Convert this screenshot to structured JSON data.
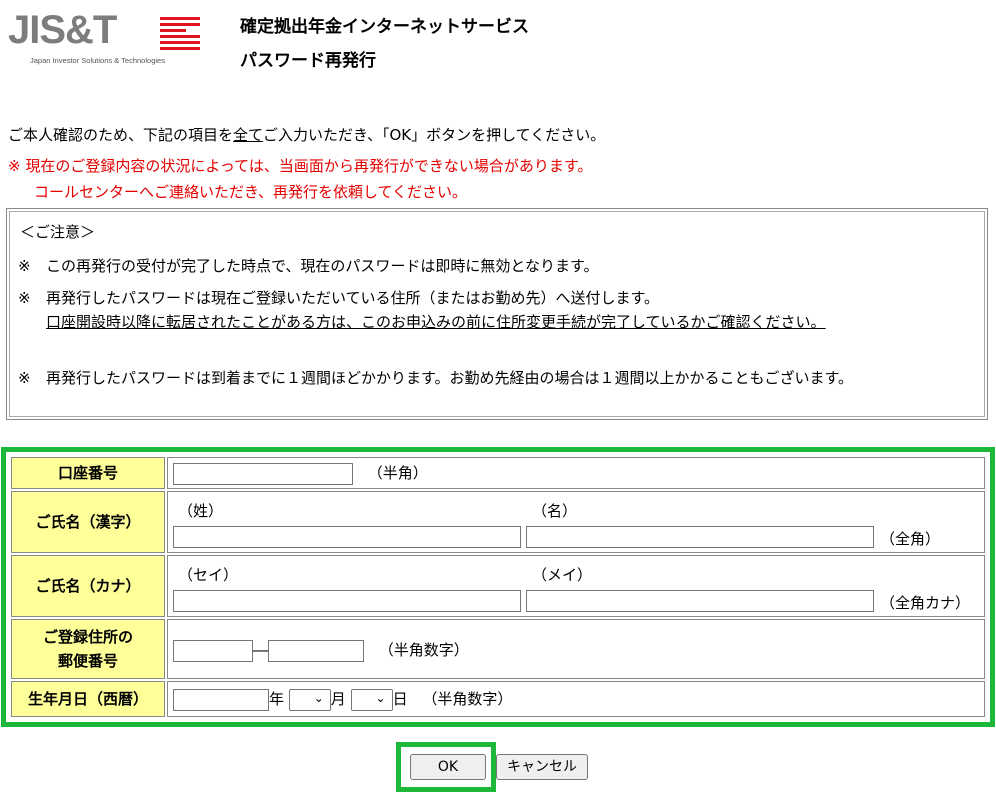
{
  "header": {
    "logo_text": "JIS&T",
    "logo_subtitle": "Japan Investor Solutions & Technologies",
    "service_name": "確定拠出年金インターネットサービス",
    "page_title": "パスワード再発行"
  },
  "intro": {
    "before": "ご本人確認のため、下記の項目を",
    "underlined": "全て",
    "after": "ご入力いただき、「OK」ボタンを押してください。"
  },
  "warning": {
    "line1": "※ 現在のご登録内容の状況によっては、当画面から再発行ができない場合があります。",
    "line2": "コールセンターへご連絡いただき、再発行を依頼してください。"
  },
  "notice": {
    "title": "＜ご注意＞",
    "mark": "※",
    "item1": "この再発行の受付が完了した時点で、現在のパスワードは即時に無効となります。",
    "item2_text": "再発行したパスワードは現在ご登録いただいている住所（またはお勤め先）へ送付します。",
    "item2_underlined": "口座開設時以降に転居されたことがある方は、このお申込みの前に住所変更手続が完了しているかご確認ください。",
    "item3": "再発行したパスワードは到着までに１週間ほどかかります。お勤め先経由の場合は１週間以上かかることもございます。"
  },
  "form": {
    "account": {
      "label": "口座番号",
      "value": "",
      "note": "（半角）"
    },
    "name_kanji": {
      "label": "ご氏名（漢字）",
      "sei_label": "（姓）",
      "mei_label": "（名）",
      "sei_value": "",
      "mei_value": "",
      "note": "（全角）"
    },
    "name_kana": {
      "label": "ご氏名（カナ）",
      "sei_label": "（セイ）",
      "mei_label": "（メイ）",
      "sei_value": "",
      "mei_value": "",
      "note": "（全角カナ）"
    },
    "postal": {
      "label_line1": "ご登録住所の",
      "label_line2": "郵便番号",
      "value1": "",
      "value2": "",
      "separator": "―",
      "note": "（半角数字）"
    },
    "birthday": {
      "label": "生年月日（西暦）",
      "year_value": "",
      "year_suffix": "年",
      "month_value": "",
      "month_suffix": "月",
      "day_value": "",
      "day_suffix": "日",
      "note": "（半角数字）"
    }
  },
  "buttons": {
    "ok_label": "OK",
    "cancel_label": "キャンセル"
  },
  "colors": {
    "highlight_frame": "#1db83a",
    "label_bg": "#ffff99",
    "warning": "#e60000",
    "logo_red": "#e0161f"
  }
}
